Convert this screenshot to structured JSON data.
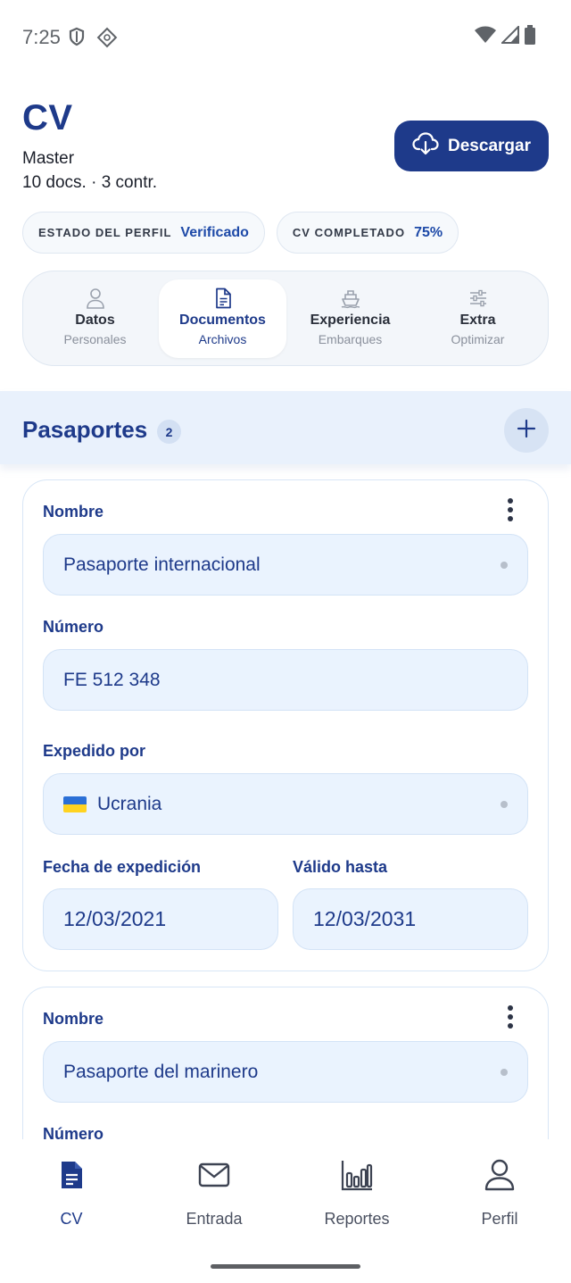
{
  "status_bar": {
    "time": "7:25"
  },
  "header": {
    "title": "CV",
    "rank": "Master",
    "meta": "10 docs. · 3 contr.",
    "download_label": "Descargar"
  },
  "chips": [
    {
      "key": "ESTADO DEL PERFIL",
      "value": "Verificado"
    },
    {
      "key": "CV COMPLETADO",
      "value": "75%"
    }
  ],
  "tabs": [
    {
      "label": "Datos",
      "sub": "Personales",
      "icon": "person-icon"
    },
    {
      "label": "Documentos",
      "sub": "Archivos",
      "icon": "document-icon",
      "active": true
    },
    {
      "label": "Experiencia",
      "sub": "Embarques",
      "icon": "ship-icon"
    },
    {
      "label": "Extra",
      "sub": "Optimizar",
      "icon": "sliders-icon"
    }
  ],
  "section": {
    "title": "Pasaportes",
    "count": "2"
  },
  "cards": [
    {
      "name_label": "Nombre",
      "name_value": "Pasaporte internacional",
      "number_label": "Número",
      "number_value": "FE 512 348",
      "issued_label": "Expedido por",
      "issued_value": "Ucrania",
      "issue_date_label": "Fecha de expedición",
      "issue_date_value": "12/03/2021",
      "valid_label": "Válido hasta",
      "valid_value": "12/03/2031"
    },
    {
      "name_label": "Nombre",
      "name_value": "Pasaporte del marinero",
      "number_label": "Número"
    }
  ],
  "bottom_nav": [
    {
      "label": "CV",
      "icon": "cv-document-icon",
      "active": true
    },
    {
      "label": "Entrada",
      "icon": "mail-icon"
    },
    {
      "label": "Reportes",
      "icon": "bar-chart-icon"
    },
    {
      "label": "Perfil",
      "icon": "person-icon"
    }
  ],
  "colors": {
    "primary": "#1e3a8a",
    "field_bg": "#eaf3fe",
    "section_bg": "#e9f1fc"
  }
}
